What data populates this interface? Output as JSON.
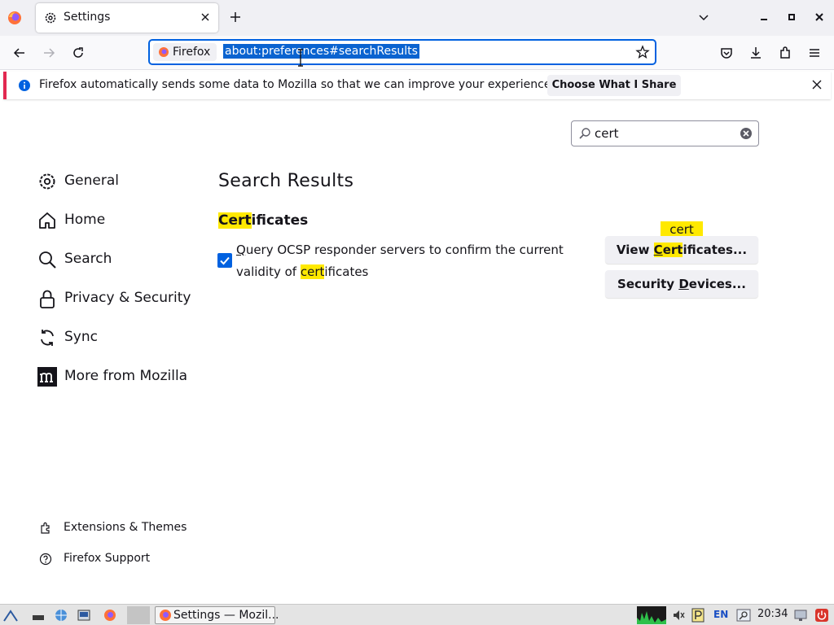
{
  "tab": {
    "title": "Settings"
  },
  "urlbar": {
    "identity_label": "Firefox",
    "url": "about:preferences#searchResults"
  },
  "notification": {
    "text": "Firefox automatically sends some data to Mozilla so that we can improve your experience.",
    "button_label": "Choose What I Share"
  },
  "prefs_search": {
    "value": "cert"
  },
  "sidebar": {
    "items": [
      {
        "label": "General",
        "icon": "gear-icon"
      },
      {
        "label": "Home",
        "icon": "home-icon"
      },
      {
        "label": "Search",
        "icon": "search-icon"
      },
      {
        "label": "Privacy & Security",
        "icon": "lock-icon"
      },
      {
        "label": "Sync",
        "icon": "sync-icon"
      },
      {
        "label": "More from Mozilla",
        "icon": "mozilla-icon"
      }
    ],
    "footer": [
      {
        "label": "Extensions & Themes",
        "icon": "puzzle-icon"
      },
      {
        "label": "Firefox Support",
        "icon": "help-icon"
      }
    ]
  },
  "results": {
    "title": "Search Results",
    "section_highlight": "Cert",
    "section_rest": "ificates",
    "ocsp": {
      "checked": true,
      "label_before": "uery OCSP responder servers to confirm the current validity of ",
      "label_access": "Q",
      "label_highlight": "cert",
      "label_after": "ificates"
    },
    "view_button": {
      "pre": "View ",
      "access_highlight": "C",
      "highlight": "ert",
      "post": "ificates..."
    },
    "security_button": {
      "pre": "Security ",
      "access": "D",
      "post": "evices..."
    },
    "tooltip": "cert"
  },
  "taskbar": {
    "window_label": "Settings — Mozil...",
    "lang": "EN",
    "clock": "20:34"
  },
  "colors": {
    "accent": "#0061e0",
    "highlight": "#ffe900",
    "notice_stripe": "#e22850"
  }
}
